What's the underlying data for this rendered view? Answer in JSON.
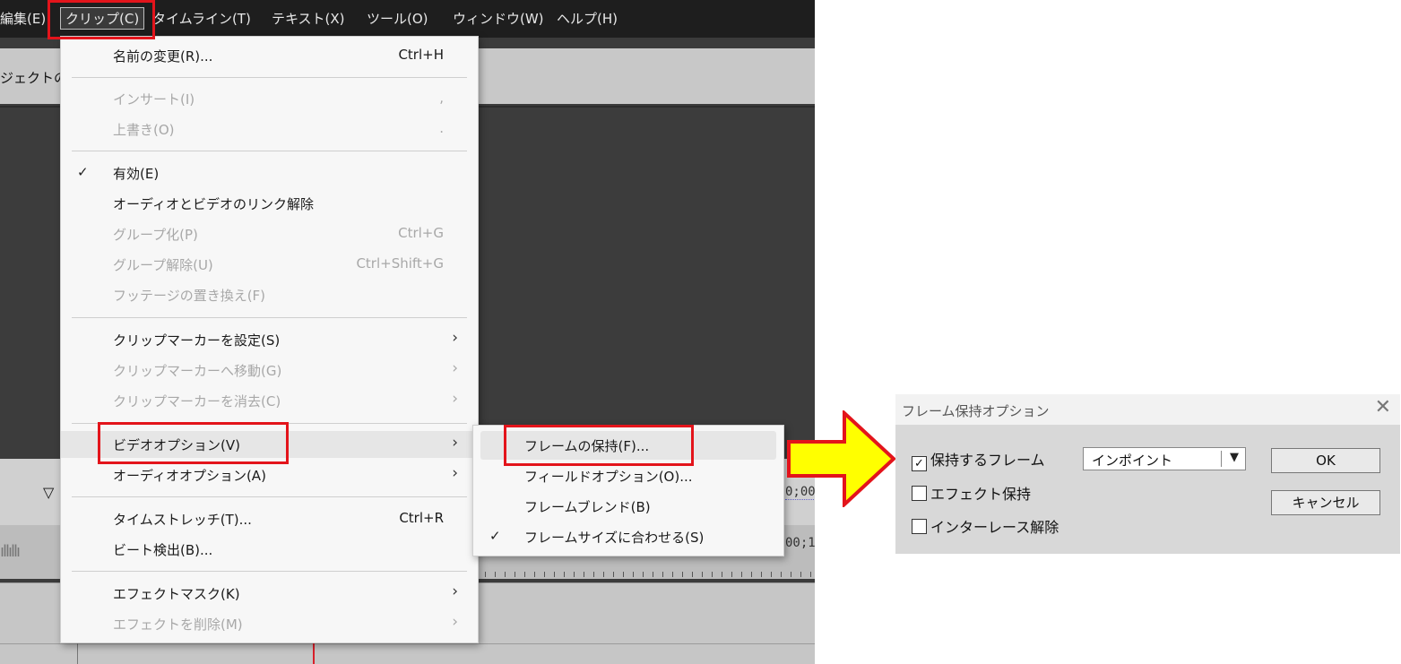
{
  "menubar": {
    "items": [
      "編集(E)",
      "クリップ(C)",
      "タイムライン(T)",
      "テキスト(X)",
      "ツール(O)",
      "ウィンドウ(W)",
      "ヘルプ(H)"
    ]
  },
  "toolbar": {
    "partial_label": "ジェクトの"
  },
  "timeline": {
    "tc1": "0;00;",
    "tc2": "00;1"
  },
  "clip_menu": {
    "rename": {
      "label": "名前の変更(R)...",
      "shortcut": "Ctrl+H"
    },
    "insert": {
      "label": "インサート(I)",
      "shortcut": ","
    },
    "overwrite": {
      "label": "上書き(O)",
      "shortcut": "."
    },
    "enable": {
      "label": "有効(E)"
    },
    "unlink": {
      "label": "オーディオとビデオのリンク解除"
    },
    "group": {
      "label": "グループ化(P)",
      "shortcut": "Ctrl+G"
    },
    "ungroup": {
      "label": "グループ解除(U)",
      "shortcut": "Ctrl+Shift+G"
    },
    "replace_footage": {
      "label": "フッテージの置き換え(F)"
    },
    "set_marker": {
      "label": "クリップマーカーを設定(S)"
    },
    "goto_marker": {
      "label": "クリップマーカーへ移動(G)"
    },
    "clear_marker": {
      "label": "クリップマーカーを消去(C)"
    },
    "video_options": {
      "label": "ビデオオプション(V)"
    },
    "audio_options": {
      "label": "オーディオオプション(A)"
    },
    "time_stretch": {
      "label": "タイムストレッチ(T)...",
      "shortcut": "Ctrl+R"
    },
    "beat_detect": {
      "label": "ビート検出(B)..."
    },
    "effect_mask": {
      "label": "エフェクトマスク(K)"
    },
    "delete_effects": {
      "label": "エフェクトを削除(M)"
    }
  },
  "video_submenu": {
    "frame_hold": "フレームの保持(F)...",
    "field_options": "フィールドオプション(O)...",
    "frame_blend": "フレームブレンド(B)",
    "scale_to_frame": "フレームサイズに合わせる(S)"
  },
  "dialog": {
    "title": "フレーム保持オプション",
    "hold_frame_label": "保持するフレーム",
    "hold_frame_checked": true,
    "hold_frame_value": "インポイント",
    "hold_effects_label": "エフェクト保持",
    "hold_effects_checked": false,
    "deinterlace_label": "インターレース解除",
    "deinterlace_checked": false,
    "ok_label": "OK",
    "cancel_label": "キャンセル"
  },
  "colors": {
    "highlight_red": "#e3141b",
    "arrow_yellow": "#ffff00"
  },
  "icons": {
    "check": "check-icon",
    "submenu": "chevron-right-icon",
    "close": "close-icon",
    "dropdown": "triangle-down-icon"
  }
}
